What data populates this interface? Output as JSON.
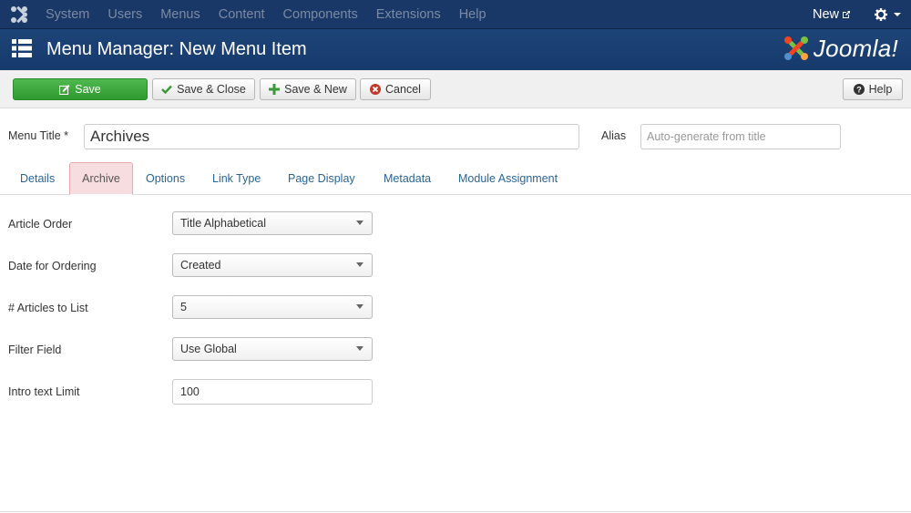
{
  "navbar": {
    "items": [
      "System",
      "Users",
      "Menus",
      "Content",
      "Components",
      "Extensions",
      "Help"
    ],
    "new_label": "New",
    "logo_icon": "joomla-logo-icon",
    "gear_icon": "gear-icon",
    "text_color": "#7a8aa4",
    "background": "#1a3867"
  },
  "header": {
    "title": "Menu Manager: New Menu Item",
    "brand": "Joomla!",
    "background": "#1b3f74"
  },
  "toolbar": {
    "save": "Save",
    "save_close": "Save & Close",
    "save_new": "Save & New",
    "cancel": "Cancel",
    "help": "Help",
    "save_color": "#3fa83f"
  },
  "form": {
    "menu_title_label": "Menu Title *",
    "menu_title_value": "Archives",
    "alias_label": "Alias",
    "alias_placeholder": "Auto-generate from title"
  },
  "tabs": [
    "Details",
    "Archive",
    "Options",
    "Link Type",
    "Page Display",
    "Metadata",
    "Module Assignment"
  ],
  "active_tab": "Archive",
  "fields": [
    {
      "label": "Article Order",
      "value": "Title Alphabetical"
    },
    {
      "label": "Date for Ordering",
      "value": "Created"
    },
    {
      "label": "# Articles to List",
      "value": "5"
    },
    {
      "label": "Filter Field",
      "value": "Use Global"
    },
    {
      "label": "Intro text Limit",
      "value": "100"
    }
  ]
}
